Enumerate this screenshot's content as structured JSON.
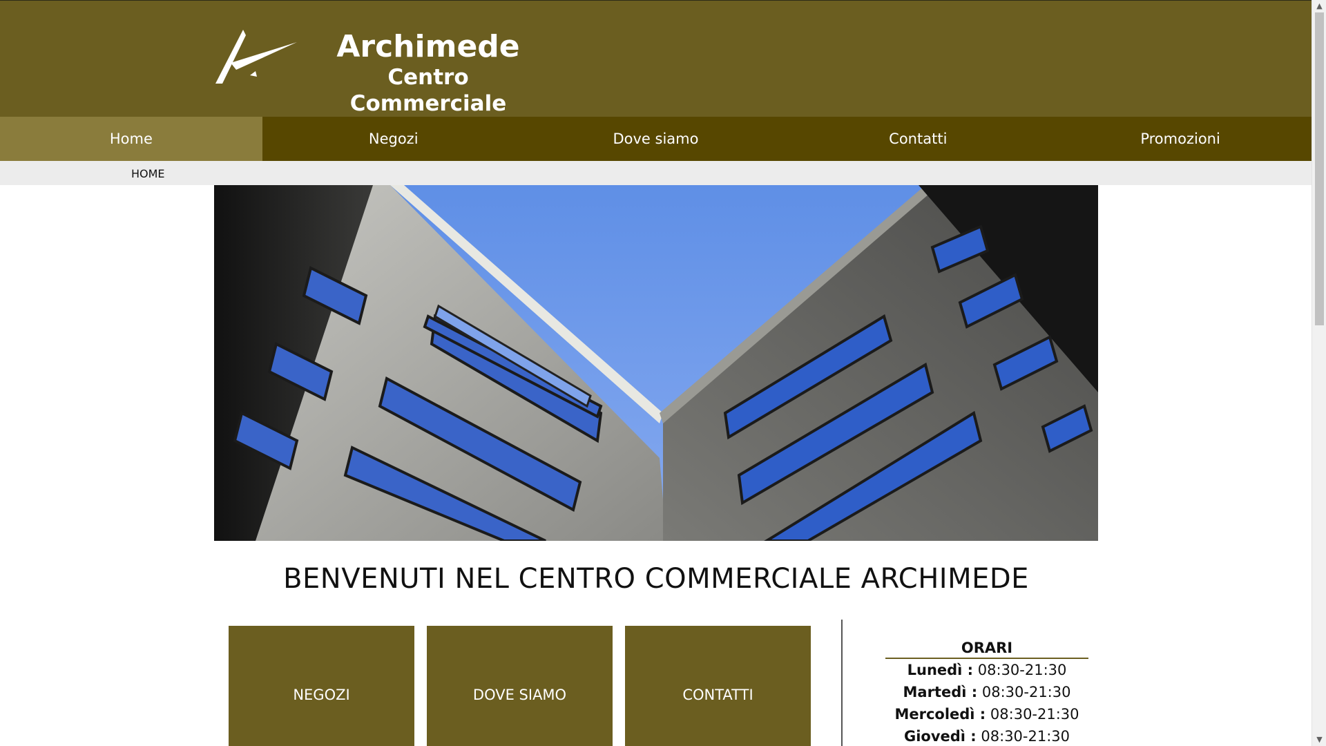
{
  "brand": {
    "title": "Archimede",
    "subtitle": "Centro Commerciale"
  },
  "nav": {
    "items": [
      {
        "label": "Home",
        "active": true
      },
      {
        "label": "Negozi",
        "active": false
      },
      {
        "label": "Dove siamo",
        "active": false
      },
      {
        "label": "Contatti",
        "active": false
      },
      {
        "label": "Promozioni",
        "active": false
      }
    ]
  },
  "breadcrumb": "HOME",
  "welcome": "BENVENUTI NEL CENTRO COMMERCIALE ARCHIMEDE",
  "tiles": [
    {
      "label": "NEGOZI"
    },
    {
      "label": "DOVE SIAMO"
    },
    {
      "label": "CONTATTI"
    }
  ],
  "hours": {
    "title": "ORARI",
    "rows": [
      {
        "day": "Lunedì :",
        "time": "08:30-21:30"
      },
      {
        "day": "Martedì :",
        "time": "08:30-21:30"
      },
      {
        "day": "Mercoledì :",
        "time": "08:30-21:30"
      },
      {
        "day": "Giovedì :",
        "time": "08:30-21:30"
      }
    ]
  },
  "colors": {
    "header": "#6b5e20",
    "nav": "#574700",
    "nav_active": "#8a7c3c",
    "tile": "#6b5e20"
  }
}
